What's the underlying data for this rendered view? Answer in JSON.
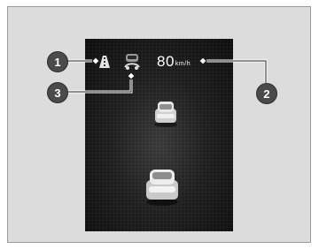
{
  "speed": {
    "value": "80",
    "unit": "km/h"
  },
  "callouts": {
    "one": "1",
    "two": "2",
    "three": "3"
  },
  "icons": {
    "lane": "lane-keeping-icon",
    "acc": "adaptive-cruise-icon"
  },
  "colors": {
    "callout": "#4a4a4a",
    "screen": "#1a1a1a",
    "frame": "#dcdcdc"
  }
}
